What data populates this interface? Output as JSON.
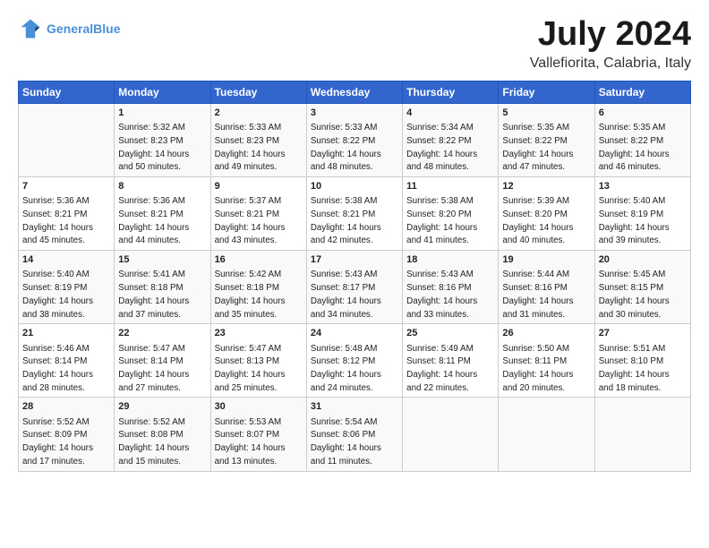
{
  "header": {
    "logo_line1": "General",
    "logo_line2": "Blue",
    "month_title": "July 2024",
    "subtitle": "Vallefiorita, Calabria, Italy"
  },
  "days_of_week": [
    "Sunday",
    "Monday",
    "Tuesday",
    "Wednesday",
    "Thursday",
    "Friday",
    "Saturday"
  ],
  "weeks": [
    [
      {
        "day": "",
        "info": ""
      },
      {
        "day": "1",
        "info": "Sunrise: 5:32 AM\nSunset: 8:23 PM\nDaylight: 14 hours\nand 50 minutes."
      },
      {
        "day": "2",
        "info": "Sunrise: 5:33 AM\nSunset: 8:23 PM\nDaylight: 14 hours\nand 49 minutes."
      },
      {
        "day": "3",
        "info": "Sunrise: 5:33 AM\nSunset: 8:22 PM\nDaylight: 14 hours\nand 48 minutes."
      },
      {
        "day": "4",
        "info": "Sunrise: 5:34 AM\nSunset: 8:22 PM\nDaylight: 14 hours\nand 48 minutes."
      },
      {
        "day": "5",
        "info": "Sunrise: 5:35 AM\nSunset: 8:22 PM\nDaylight: 14 hours\nand 47 minutes."
      },
      {
        "day": "6",
        "info": "Sunrise: 5:35 AM\nSunset: 8:22 PM\nDaylight: 14 hours\nand 46 minutes."
      }
    ],
    [
      {
        "day": "7",
        "info": "Sunrise: 5:36 AM\nSunset: 8:21 PM\nDaylight: 14 hours\nand 45 minutes."
      },
      {
        "day": "8",
        "info": "Sunrise: 5:36 AM\nSunset: 8:21 PM\nDaylight: 14 hours\nand 44 minutes."
      },
      {
        "day": "9",
        "info": "Sunrise: 5:37 AM\nSunset: 8:21 PM\nDaylight: 14 hours\nand 43 minutes."
      },
      {
        "day": "10",
        "info": "Sunrise: 5:38 AM\nSunset: 8:21 PM\nDaylight: 14 hours\nand 42 minutes."
      },
      {
        "day": "11",
        "info": "Sunrise: 5:38 AM\nSunset: 8:20 PM\nDaylight: 14 hours\nand 41 minutes."
      },
      {
        "day": "12",
        "info": "Sunrise: 5:39 AM\nSunset: 8:20 PM\nDaylight: 14 hours\nand 40 minutes."
      },
      {
        "day": "13",
        "info": "Sunrise: 5:40 AM\nSunset: 8:19 PM\nDaylight: 14 hours\nand 39 minutes."
      }
    ],
    [
      {
        "day": "14",
        "info": "Sunrise: 5:40 AM\nSunset: 8:19 PM\nDaylight: 14 hours\nand 38 minutes."
      },
      {
        "day": "15",
        "info": "Sunrise: 5:41 AM\nSunset: 8:18 PM\nDaylight: 14 hours\nand 37 minutes."
      },
      {
        "day": "16",
        "info": "Sunrise: 5:42 AM\nSunset: 8:18 PM\nDaylight: 14 hours\nand 35 minutes."
      },
      {
        "day": "17",
        "info": "Sunrise: 5:43 AM\nSunset: 8:17 PM\nDaylight: 14 hours\nand 34 minutes."
      },
      {
        "day": "18",
        "info": "Sunrise: 5:43 AM\nSunset: 8:16 PM\nDaylight: 14 hours\nand 33 minutes."
      },
      {
        "day": "19",
        "info": "Sunrise: 5:44 AM\nSunset: 8:16 PM\nDaylight: 14 hours\nand 31 minutes."
      },
      {
        "day": "20",
        "info": "Sunrise: 5:45 AM\nSunset: 8:15 PM\nDaylight: 14 hours\nand 30 minutes."
      }
    ],
    [
      {
        "day": "21",
        "info": "Sunrise: 5:46 AM\nSunset: 8:14 PM\nDaylight: 14 hours\nand 28 minutes."
      },
      {
        "day": "22",
        "info": "Sunrise: 5:47 AM\nSunset: 8:14 PM\nDaylight: 14 hours\nand 27 minutes."
      },
      {
        "day": "23",
        "info": "Sunrise: 5:47 AM\nSunset: 8:13 PM\nDaylight: 14 hours\nand 25 minutes."
      },
      {
        "day": "24",
        "info": "Sunrise: 5:48 AM\nSunset: 8:12 PM\nDaylight: 14 hours\nand 24 minutes."
      },
      {
        "day": "25",
        "info": "Sunrise: 5:49 AM\nSunset: 8:11 PM\nDaylight: 14 hours\nand 22 minutes."
      },
      {
        "day": "26",
        "info": "Sunrise: 5:50 AM\nSunset: 8:11 PM\nDaylight: 14 hours\nand 20 minutes."
      },
      {
        "day": "27",
        "info": "Sunrise: 5:51 AM\nSunset: 8:10 PM\nDaylight: 14 hours\nand 18 minutes."
      }
    ],
    [
      {
        "day": "28",
        "info": "Sunrise: 5:52 AM\nSunset: 8:09 PM\nDaylight: 14 hours\nand 17 minutes."
      },
      {
        "day": "29",
        "info": "Sunrise: 5:52 AM\nSunset: 8:08 PM\nDaylight: 14 hours\nand 15 minutes."
      },
      {
        "day": "30",
        "info": "Sunrise: 5:53 AM\nSunset: 8:07 PM\nDaylight: 14 hours\nand 13 minutes."
      },
      {
        "day": "31",
        "info": "Sunrise: 5:54 AM\nSunset: 8:06 PM\nDaylight: 14 hours\nand 11 minutes."
      },
      {
        "day": "",
        "info": ""
      },
      {
        "day": "",
        "info": ""
      },
      {
        "day": "",
        "info": ""
      }
    ]
  ]
}
